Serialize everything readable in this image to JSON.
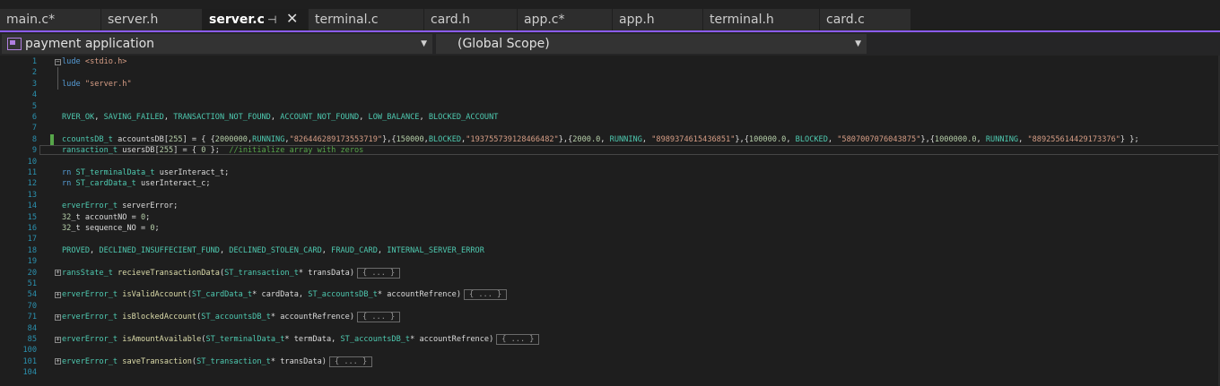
{
  "tabs": [
    {
      "label": "main.c*",
      "active": false
    },
    {
      "label": "server.h",
      "active": false
    },
    {
      "label": "server.c",
      "active": true
    },
    {
      "label": "terminal.c",
      "active": false
    },
    {
      "label": "card.h",
      "active": false
    },
    {
      "label": "app.c*",
      "active": false
    },
    {
      "label": "app.h",
      "active": false
    },
    {
      "label": "terminal.h",
      "active": false
    },
    {
      "label": "card.c",
      "active": false
    }
  ],
  "tab_icons": {
    "pin": "pin-icon",
    "close": "close-icon"
  },
  "navbar": {
    "project": "payment application",
    "scope": "(Global Scope)"
  },
  "colors": {
    "accent": "#8b5cf6",
    "keyword": "#569cd6",
    "type": "#4ec9b0",
    "string": "#d69d85",
    "comment": "#57a64a",
    "line_number": "#2b91af"
  },
  "code_lines": [
    {
      "n": "1",
      "t": "lude <stdio.h>"
    },
    {
      "n": "2",
      "t": ""
    },
    {
      "n": "3",
      "t": "lude \"server.h\""
    },
    {
      "n": "4",
      "t": ""
    },
    {
      "n": "5",
      "t": ""
    },
    {
      "n": "6",
      "t": "RVER_OK, SAVING_FAILED, TRANSACTION_NOT_FOUND, ACCOUNT_NOT_FOUND, LOW_BALANCE, BLOCKED_ACCOUNT"
    },
    {
      "n": "7",
      "t": ""
    },
    {
      "n": "8",
      "t": "ccountsDB_t accountsDB[255] = { {2000000,RUNNING,\"826446289173553719\"},{150000,BLOCKED,\"193755739128466482\"},{2000.0, RUNNING, \"8989374615436851\"},{100000.0, BLOCKED, \"5807007076043875\"},{1000000.0, RUNNING, \"889255614429173376\"} };"
    },
    {
      "n": "9",
      "t": "ransaction_t usersDB[255] = { 0 };  //initialize array with zeros"
    },
    {
      "n": "10",
      "t": ""
    },
    {
      "n": "11",
      "t": "rn ST_terminalData_t userInteract_t;"
    },
    {
      "n": "12",
      "t": "rn ST_cardData_t userInteract_c;"
    },
    {
      "n": "13",
      "t": ""
    },
    {
      "n": "14",
      "t": "erverError_t serverError;"
    },
    {
      "n": "15",
      "t": "32_t accountNO = 0;"
    },
    {
      "n": "16",
      "t": "32_t sequence_NO = 0;"
    },
    {
      "n": "17",
      "t": ""
    },
    {
      "n": "18",
      "t": "PROVED, DECLINED_INSUFFECIENT_FUND, DECLINED_STOLEN_CARD, FRAUD_CARD, INTERNAL_SERVER_ERROR"
    },
    {
      "n": "19",
      "t": ""
    },
    {
      "n": "20",
      "t": "ransState_t recieveTransactionData(ST_transaction_t* transData)",
      "collapsed": "{ ... }"
    },
    {
      "n": "51",
      "t": ""
    },
    {
      "n": "54",
      "t": "erverError_t isValidAccount(ST_cardData_t* cardData, ST_accountsDB_t* accountRefrence)",
      "collapsed": "{ ... }"
    },
    {
      "n": "70",
      "t": ""
    },
    {
      "n": "71",
      "t": "erverError_t isBlockedAccount(ST_accountsDB_t* accountRefrence)",
      "collapsed": "{ ... }"
    },
    {
      "n": "84",
      "t": ""
    },
    {
      "n": "85",
      "t": "erverError_t isAmountAvailable(ST_terminalData_t* termData, ST_accountsDB_t* accountRefrence)",
      "collapsed": "{ ... }"
    },
    {
      "n": "100",
      "t": ""
    },
    {
      "n": "101",
      "t": "erverError_t saveTransaction(ST_transaction_t* transData)",
      "collapsed": "{ ... }"
    },
    {
      "n": "104",
      "t": ""
    }
  ]
}
